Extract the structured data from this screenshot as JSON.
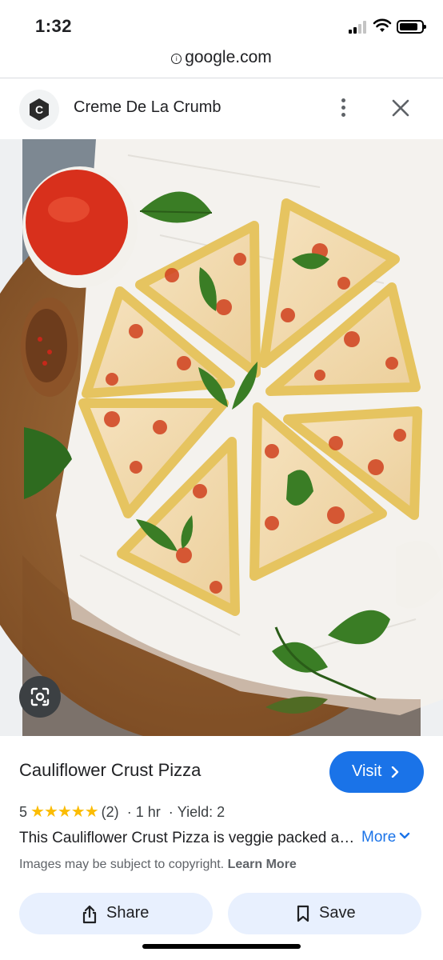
{
  "status_bar": {
    "time": "1:32"
  },
  "browser": {
    "url": "google.com"
  },
  "source": {
    "name": "Creme De La Crumb",
    "logo_letter": "C"
  },
  "recipe": {
    "title": "Cauliflower Crust Pizza",
    "visit_label": "Visit",
    "rating": "5",
    "stars": "★★★★★",
    "reviews": "(2)",
    "separator": "·",
    "time": "1 hr",
    "yield": "Yield: 2",
    "description": "This Cauliflower Crust Pizza is veggie packed and delicious",
    "more_label": "More",
    "copyright": "Images may be subject to copyright.",
    "learn_more": "Learn More"
  },
  "actions": {
    "share_label": "Share",
    "save_label": "Save"
  },
  "icons": {
    "lock": "lock-icon",
    "more": "more-vert-icon",
    "close": "close-icon",
    "lens": "lens-icon",
    "chevron_right": "chevron-right-icon",
    "chevron_down": "chevron-down-icon",
    "share": "share-icon",
    "bookmark": "bookmark-icon"
  },
  "colors": {
    "accent": "#1a73e8",
    "star": "#fbbc04",
    "button_bg": "#e8f0fe"
  }
}
